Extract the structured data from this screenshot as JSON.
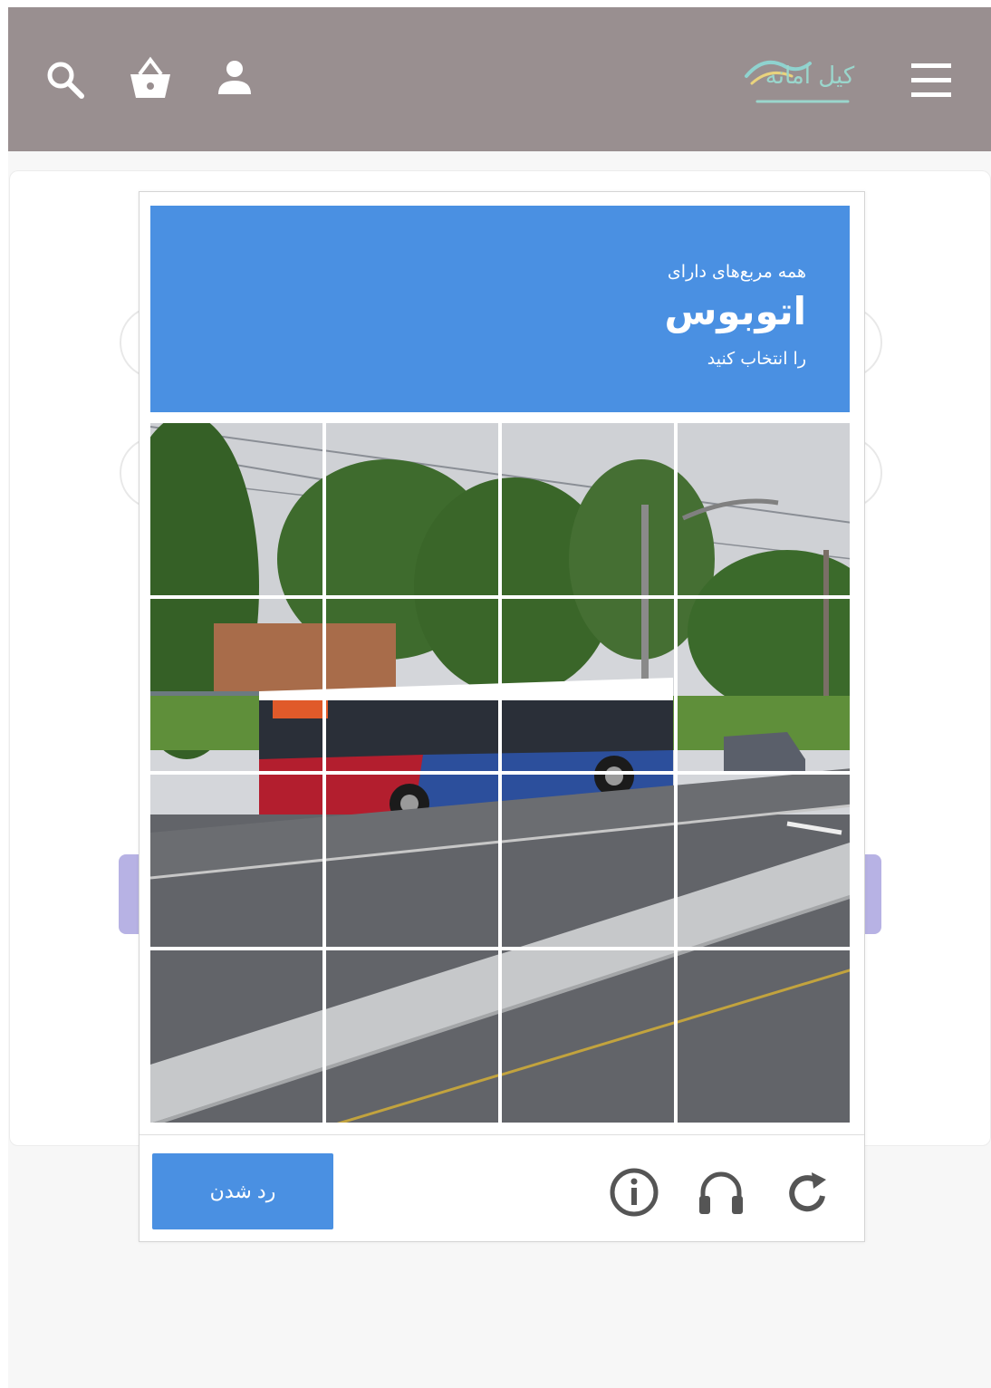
{
  "header": {
    "logo_text": "کیل امانه",
    "icons": [
      "search-icon",
      "basket-icon",
      "user-icon",
      "menu-icon"
    ]
  },
  "captcha": {
    "prompt_line1": "همه مربع‌های دارای",
    "target": "اتوبوس",
    "prompt_line3": "را انتخاب کنید",
    "skip_label": "رد شدن",
    "grid_rows": 4,
    "grid_cols": 4,
    "footer_icons": [
      "info-icon",
      "headphones-icon",
      "reload-icon"
    ]
  },
  "colors": {
    "header_bg": "#998f90",
    "captcha_accent": "#4a90e2",
    "ghost_button": "#b7b2e4"
  }
}
